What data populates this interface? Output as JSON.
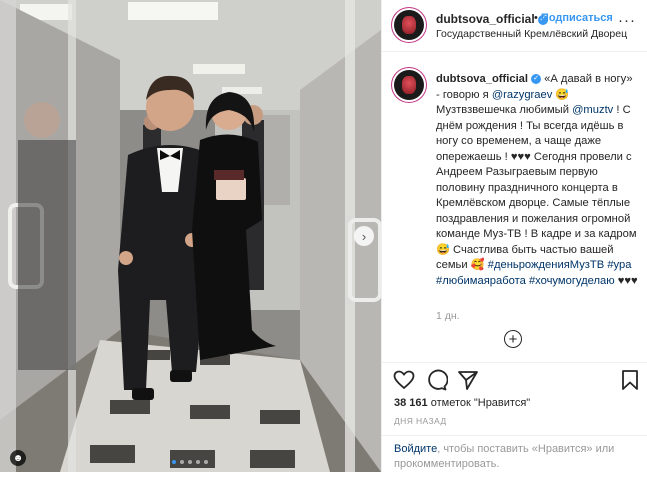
{
  "post": {
    "username": "dubtsova_official",
    "follow_label": "Подписаться",
    "separator": "•",
    "location": "Государственный Кремлёвский Дворец",
    "more_icon": "more-dots-icon"
  },
  "caption": {
    "username": "dubtsova_official",
    "text_1": "«А давай в ногу» - говорю я ",
    "mention_1": "@razygraev",
    "text_2": " 😅 Музтвзвешечка любимый ",
    "mention_2": "@muztv",
    "text_3": " ! С днём рождения ! Ты всегда идёшь в ногу со временем, а чаще даже опережаешь ! ♥♥♥ Сегодня провели с Андреем Разыграевым первую половину праздничного концерта в Кремлёвском дворце. Самые тёплые поздравления и пожелания огромной команде Муз-ТВ ! В кадре и за кадром 😅 Счастлива быть частью вашей семьи 🥰 ",
    "hashtag_1": "#деньрожденияМузТВ",
    "hashtag_2": "#ура",
    "hashtag_3": "#любимаяработа",
    "hashtag_4": "#хочумогуделаю",
    "tail": " ♥♥♥",
    "age": "1 дн."
  },
  "actions": {
    "likes_count": "38 161",
    "likes_text": " отметок \"Нравится\"",
    "date": "ДНЯ НАЗАД",
    "login_link": "Войдите",
    "login_text": ", чтобы поставить «Нравится» или прокомментировать."
  },
  "carousel": {
    "next_icon": "chevron-right-icon",
    "dots": 5,
    "active_dot": 1
  },
  "colors": {
    "accent": "#3897f0",
    "link": "#003569",
    "muted": "#999999",
    "border": "#efefef"
  }
}
